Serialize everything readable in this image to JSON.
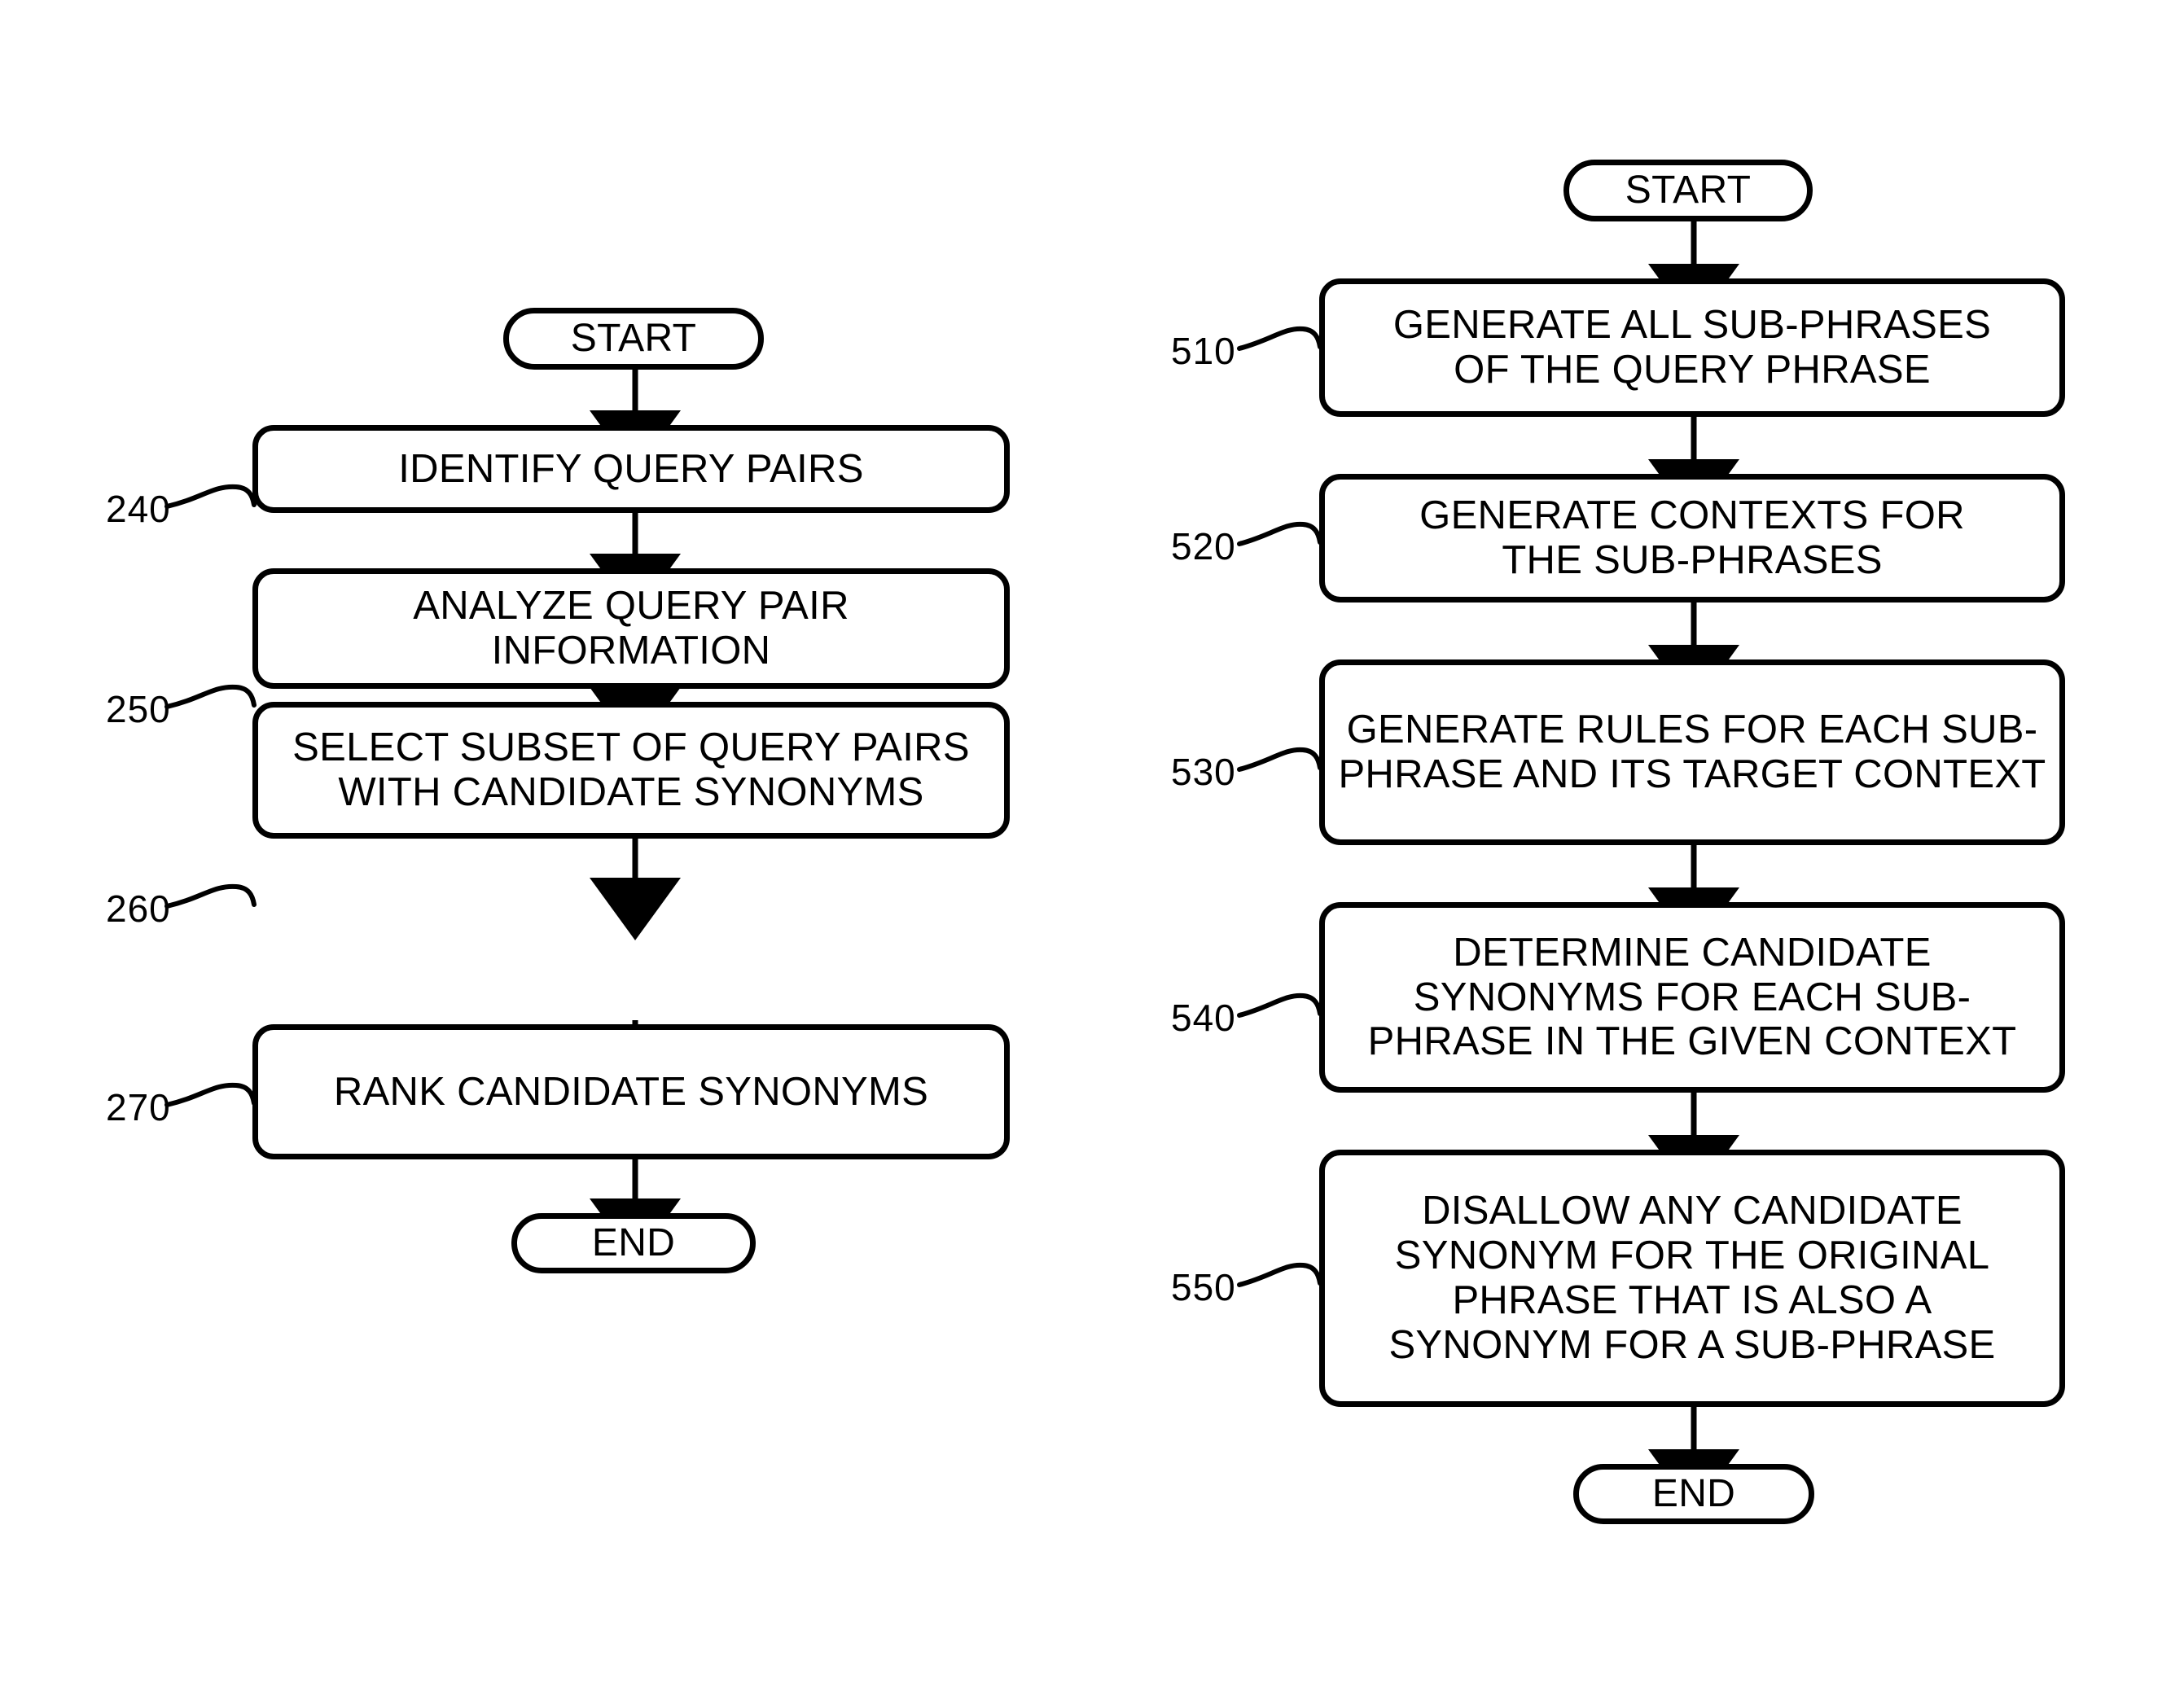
{
  "figure": {
    "kind": "patent-flowchart",
    "line_color": "#000000",
    "background": "#ffffff"
  },
  "left_flow": {
    "start_label": "START",
    "end_label": "END",
    "steps": [
      {
        "ref": "240",
        "text": "IDENTIFY QUERY PAIRS"
      },
      {
        "ref": "250",
        "text": "ANALYZE QUERY PAIR INFORMATION"
      },
      {
        "ref": "260",
        "text": "SELECT SUBSET OF QUERY PAIRS WITH CANDIDATE SYNONYMS"
      },
      {
        "ref": "270",
        "text": "RANK CANDIDATE SYNONYMS"
      }
    ]
  },
  "right_flow": {
    "start_label": "START",
    "end_label": "END",
    "steps": [
      {
        "ref": "510",
        "text": "GENERATE ALL SUB-PHRASES OF THE QUERY PHRASE"
      },
      {
        "ref": "520",
        "text": "GENERATE CONTEXTS FOR THE SUB-PHRASES"
      },
      {
        "ref": "530",
        "text": "GENERATE RULES FOR EACH SUB-PHRASE AND ITS TARGET CONTEXT"
      },
      {
        "ref": "540",
        "text": "DETERMINE CANDIDATE SYNONYMS FOR EACH SUB-PHRASE IN THE GIVEN CONTEXT"
      },
      {
        "ref": "550",
        "text": "DISALLOW ANY CANDIDATE SYNONYM FOR THE ORIGINAL PHRASE THAT IS ALSO A SYNONYM FOR A SUB-PHRASE"
      }
    ]
  }
}
